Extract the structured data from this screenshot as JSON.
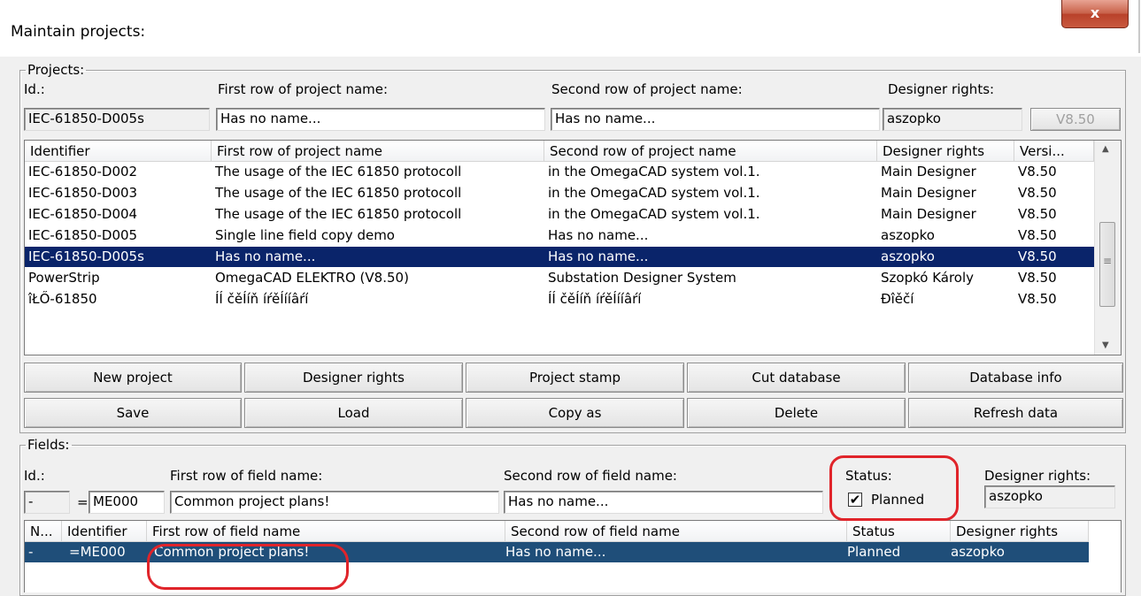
{
  "window": {
    "title": "Maintain projects:",
    "close_label": "x"
  },
  "projects": {
    "group_label": "Projects:",
    "id_label": "Id.:",
    "first_row_label": "First row of project name:",
    "second_row_label": "Second row of project name:",
    "designer_rights_label": "Designer rights:",
    "id_value": "IEC-61850-D005s",
    "first_row_value": "Has no name...",
    "second_row_value": "Has no name...",
    "designer_rights_value": "aszopko",
    "version_button": "V8.50",
    "columns": [
      "Identifier",
      "First row of project name",
      "Second row of project name",
      "Designer rights",
      "Versi..."
    ],
    "rows": [
      [
        "IEC-61850-D002",
        "The usage of the IEC 61850 protocoll",
        "in the OmegaCAD system vol.1.",
        "Main Designer",
        "V8.50"
      ],
      [
        "IEC-61850-D003",
        "The usage of the IEC 61850 protocoll",
        "in the OmegaCAD system vol.1.",
        "Main Designer",
        "V8.50"
      ],
      [
        "IEC-61850-D004",
        "The usage of the IEC 61850 protocoll",
        "in the OmegaCAD system vol.1.",
        "Main Designer",
        "V8.50"
      ],
      [
        "IEC-61850-D005",
        "Single line field copy demo",
        "Has no name...",
        "aszopko",
        "V8.50"
      ],
      [
        "IEC-61850-D005s",
        "Has no name...",
        "Has no name...",
        "aszopko",
        "V8.50"
      ],
      [
        "PowerStrip",
        "OmegaCAD ELEKTRO (V8.50)",
        "Substation Designer System",
        "Szopkó Károly",
        "V8.50"
      ],
      [
        "îŁŐ-61850",
        "ÍÍ čěÍíň íŕěÍííâŕí",
        "ÍÍ čěÍíň íŕěÍííâŕí",
        "Đîěčí",
        "V8.50"
      ]
    ],
    "selected_row": 4,
    "buttons": {
      "new_project": "New project",
      "designer_rights": "Designer rights",
      "project_stamp": "Project stamp",
      "cut_database": "Cut database",
      "database_info": "Database info",
      "save": "Save",
      "load": "Load",
      "copy_as": "Copy as",
      "delete": "Delete",
      "refresh_data": "Refresh data"
    }
  },
  "fields": {
    "group_label": "Fields:",
    "id_label": "Id.:",
    "first_row_label": "First row of field name:",
    "second_row_label": "Second row of field name:",
    "status_label": "Status:",
    "designer_rights_label": "Designer rights:",
    "id_prefix_value": "-",
    "equals_sign": "=",
    "id_value": "ME000",
    "first_row_value": "Common project plans!",
    "second_row_value": "Has no name...",
    "status_checkbox_label": "Planned",
    "status_checked": true,
    "designer_rights_value": "aszopko",
    "columns": [
      "N...",
      "Identifier",
      "First row of field name",
      "Second row of field name",
      "Status",
      "Designer rights"
    ],
    "rows": [
      [
        "-",
        "=ME000",
        "Common project plans!",
        "Has no name...",
        "Planned",
        "aszopko"
      ]
    ],
    "selected_row": 0
  },
  "icons": {
    "scroll_up": "scroll-up-arrow-icon",
    "scroll_down": "scroll-down-arrow-icon",
    "checkmark": "checkmark-icon"
  },
  "colors": {
    "selection": "#0a246a",
    "fields_selection": "#1f4e79",
    "annotation": "#e0242a"
  },
  "checkmark_glyph": "✔",
  "scroll_up_glyph": "▲",
  "scroll_down_glyph": "▼",
  "scroll_grip_glyph": "≡"
}
